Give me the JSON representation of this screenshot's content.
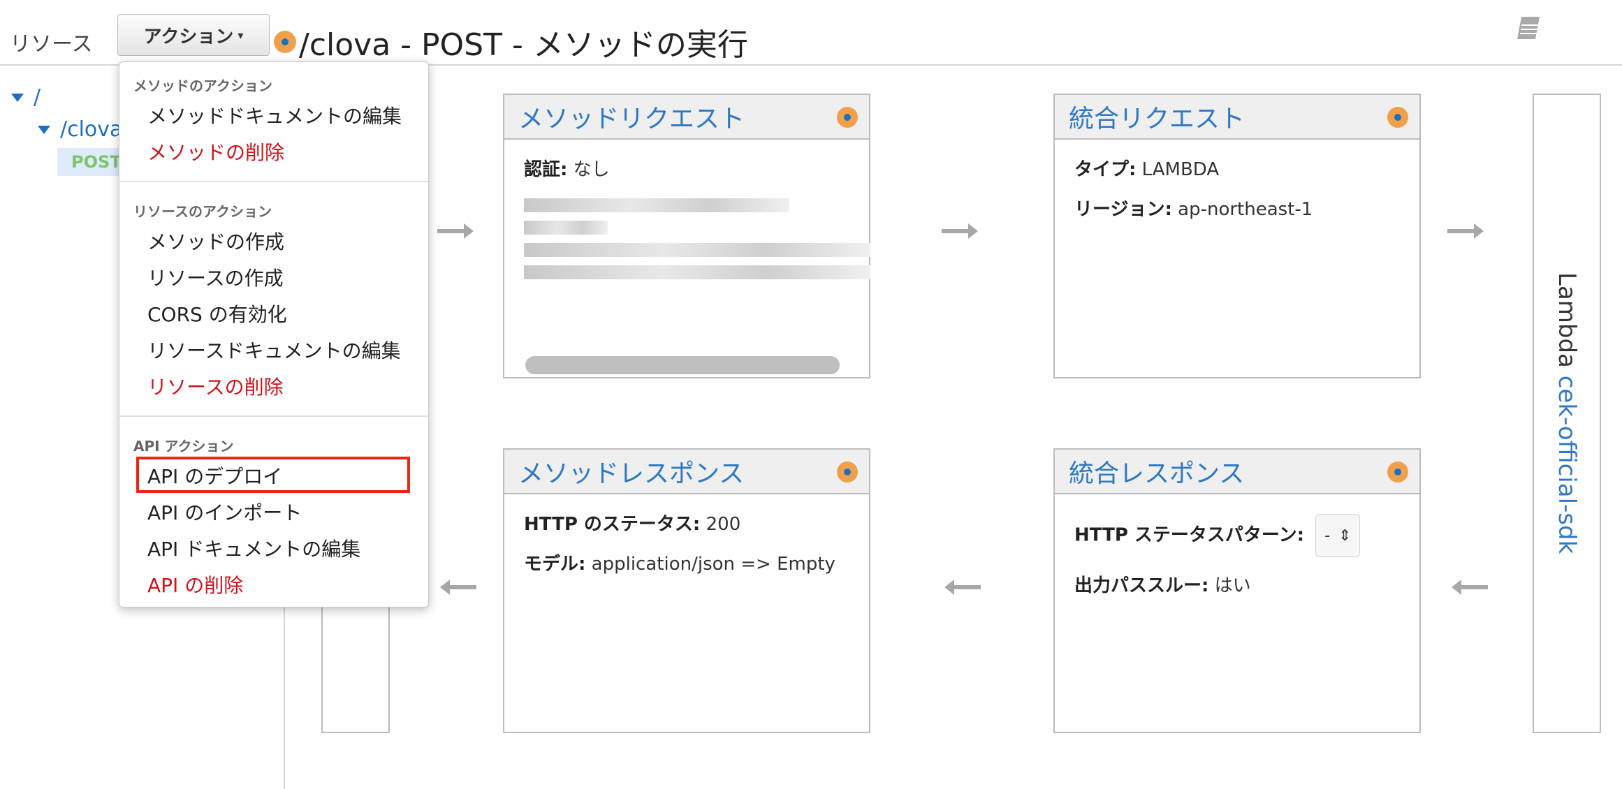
{
  "header": {
    "resources_label": "リソース",
    "actions_label": "アクション",
    "title": "/clova - POST - メソッドの実行"
  },
  "tree": {
    "root": "/",
    "clova": "/clova",
    "post": "POST"
  },
  "menu": {
    "method_section": "メソッドのアクション",
    "method_items": [
      "メソッドドキュメントの編集",
      "メソッドの削除"
    ],
    "resource_section": "リソースのアクション",
    "resource_items": [
      "メソッドの作成",
      "リソースの作成",
      "CORS の有効化",
      "リソースドキュメントの編集",
      "リソースの削除"
    ],
    "api_section": "API アクション",
    "api_items": [
      "API のデプロイ",
      "API のインポート",
      "API ドキュメントの編集",
      "API の削除"
    ]
  },
  "method_request": {
    "title": "メソッドリクエスト",
    "auth_label": "認証:",
    "auth_value": "なし"
  },
  "integration_request": {
    "title": "統合リクエスト",
    "type_label": "タイプ:",
    "type_value": "LAMBDA",
    "region_label": "リージョン:",
    "region_value": "ap-northeast-1"
  },
  "method_response": {
    "title": "メソッドレスポンス",
    "status_label": "HTTP のステータス:",
    "status_value": "200",
    "model_label": "モデル:",
    "model_value": "application/json => Empty"
  },
  "integration_response": {
    "title": "統合レスポンス",
    "pattern_label": "HTTP ステータスパターン:",
    "pattern_value": "-",
    "passthrough_label": "出力パススルー:",
    "passthrough_value": "はい"
  },
  "lambda": {
    "prefix": "Lambda",
    "function_name": "cek-official-sdk"
  },
  "colors": {
    "link_blue": "#2f78c4",
    "danger_red": "#d0121a",
    "highlight_red": "#ee2513",
    "resource_dot": "#f0a04b",
    "post_green": "#7cc56d"
  }
}
